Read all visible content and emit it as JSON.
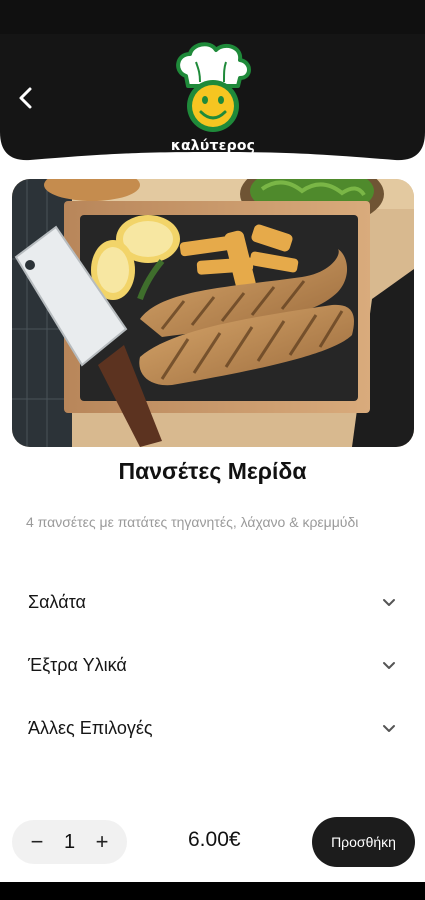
{
  "header": {
    "back_icon": "chevron-left-icon",
    "logo_text": "καλύτερος",
    "colors": {
      "header_bg": "#151515",
      "logo_green": "#1f8a3a",
      "logo_yellow": "#f6c521"
    }
  },
  "product": {
    "title": "Πανσέτες Μερίδα",
    "description": "4 πανσέτες με πατάτες τηγανητές, λάχανο & κρεμμύδι"
  },
  "options": [
    {
      "label": "Σαλάτα",
      "icon": "chevron-down-icon"
    },
    {
      "label": "Έξτρα Υλικά",
      "icon": "chevron-down-icon"
    },
    {
      "label": "Άλλες Επιλογές",
      "icon": "chevron-down-icon"
    }
  ],
  "cart": {
    "minus": "−",
    "quantity": "1",
    "plus": "+",
    "price": "6.00€",
    "add_label": "Προσθήκη"
  }
}
